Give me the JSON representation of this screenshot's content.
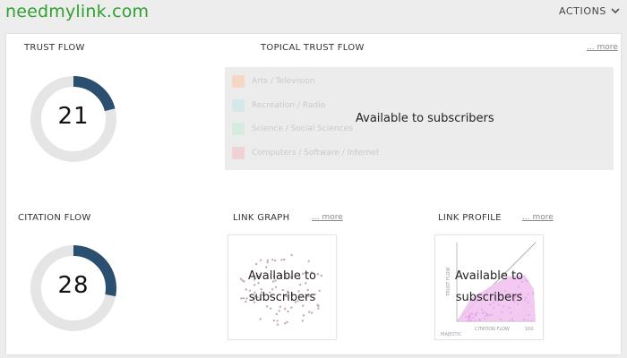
{
  "header": {
    "site_title": "needmylink.com",
    "actions_label": "ACTIONS"
  },
  "trust_flow": {
    "label": "TRUST FLOW",
    "value": "21",
    "ring_fraction": 0.21,
    "ring_color": "#2b4f6e",
    "track_color": "#e5e5e5"
  },
  "citation_flow": {
    "label": "CITATION FLOW",
    "value": "28",
    "ring_fraction": 0.28,
    "ring_color": "#2b4f6e",
    "track_color": "#e5e5e5"
  },
  "topical_trust_flow": {
    "label": "TOPICAL TRUST FLOW",
    "more_label": "... more",
    "overlay_text": "Available to subscribers",
    "topics": [
      {
        "label": "Arts / Television",
        "color": "#f6d6c4"
      },
      {
        "label": "Recreation / Radio",
        "color": "#d6e8ea"
      },
      {
        "label": "Science / Social Sciences",
        "color": "#d6ecdc"
      },
      {
        "label": "Computers / Software / Internet",
        "color": "#f0d2d4"
      }
    ]
  },
  "link_graph": {
    "label": "LINK GRAPH",
    "more_label": "... more",
    "overlay_line1": "Available to",
    "overlay_line2": "subscribers"
  },
  "link_profile": {
    "label": "LINK PROFILE",
    "more_label": "... more",
    "overlay_line1": "Available to",
    "overlay_line2": "subscribers",
    "axis_x_label": "CITATION FLOW",
    "axis_y_label": "TRUST FLOW",
    "axis_max": "100",
    "brand": "MAJESTIC"
  }
}
